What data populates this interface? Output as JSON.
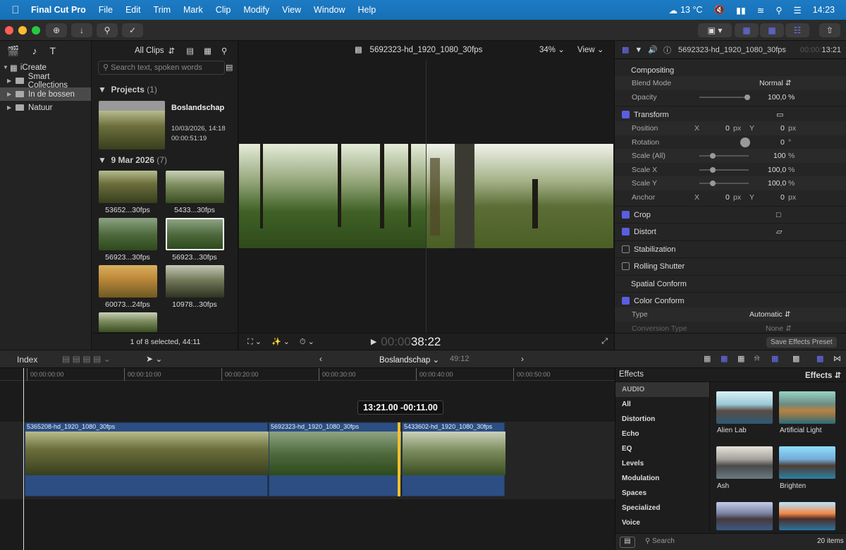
{
  "menubar": {
    "app": "Final Cut Pro",
    "items": [
      "File",
      "Edit",
      "Trim",
      "Mark",
      "Clip",
      "Modify",
      "View",
      "Window",
      "Help"
    ],
    "weather": "13 °C",
    "clock": "14:23"
  },
  "browser": {
    "library": "iCreate",
    "items": [
      "Smart Collections",
      "In de bossen",
      "Natuur"
    ],
    "filter": "All Clips",
    "search_placeholder": "Search text, spoken words",
    "projects_header": "Projects",
    "projects_count": "(1)",
    "project": {
      "name": "Boslandschap",
      "date": "10/03/2026, 14:18",
      "duration": "00:00:51:19"
    },
    "date_header": "9 Mar 2026",
    "date_count": "(7)",
    "clips": [
      "53652...30fps",
      "5433...30fps",
      "56923...30fps",
      "56923...30fps",
      "60073...24fps",
      "10978...30fps"
    ],
    "status": "1 of 8 selected, 44:11"
  },
  "viewer": {
    "title": "5692323-hd_1920_1080_30fps",
    "zoom": "34%",
    "view_label": "View",
    "timecode_dim": "00:00",
    "timecode": "38:22"
  },
  "inspector": {
    "clip_name": "5692323-hd_1920_1080_30fps",
    "tc_dim": "00:00:",
    "tc": "13:21",
    "compositing": "Compositing",
    "blend_label": "Blend Mode",
    "blend_value": "Normal",
    "opacity_label": "Opacity",
    "opacity_value": "100,0",
    "transform": "Transform",
    "position": "Position",
    "pos_x": "0",
    "pos_y": "0",
    "rotation": "Rotation",
    "rot_value": "0",
    "scale_all": "Scale (All)",
    "scale_all_value": "100",
    "scale_x": "Scale X",
    "scale_x_value": "100,0",
    "scale_y": "Scale Y",
    "scale_y_value": "100,0",
    "anchor": "Anchor",
    "anc_x": "0",
    "anc_y": "0",
    "crop": "Crop",
    "distort": "Distort",
    "stabilization": "Stabilization",
    "rolling": "Rolling Shutter",
    "spatial": "Spatial Conform",
    "color_conform": "Color Conform",
    "type_label": "Type",
    "type_value": "Automatic",
    "conversion_label": "Conversion Type",
    "conversion_value": "None",
    "save_preset": "Save Effects Preset",
    "unit_px": "px",
    "unit_pct": "%",
    "unit_deg": "°",
    "x": "X",
    "y": "Y"
  },
  "timeline": {
    "index": "Index",
    "project": "Boslandschap",
    "duration": "49:12",
    "ticks": [
      "00:00:00:00",
      "00:00:10:00",
      "00:00:20:00",
      "00:00:30:00",
      "00:00:40:00",
      "00:00:50:00"
    ],
    "tooltip": "13:21.00  -00:11.00",
    "clips": [
      "5365208-hd_1920_1080_30fps",
      "5692323-hd_1920_1080_30fps",
      "5433602-hd_1920_1080_30fps"
    ]
  },
  "effects": {
    "header": "Effects",
    "dropdown": "Effects",
    "categories": [
      "AUDIO",
      "All",
      "Distortion",
      "Echo",
      "EQ",
      "Levels",
      "Modulation",
      "Spaces",
      "Specialized",
      "Voice"
    ],
    "items": [
      "Alien Lab",
      "Artificial Light",
      "Ash",
      "Brighten"
    ],
    "search_placeholder": "Search",
    "count": "20 items"
  }
}
